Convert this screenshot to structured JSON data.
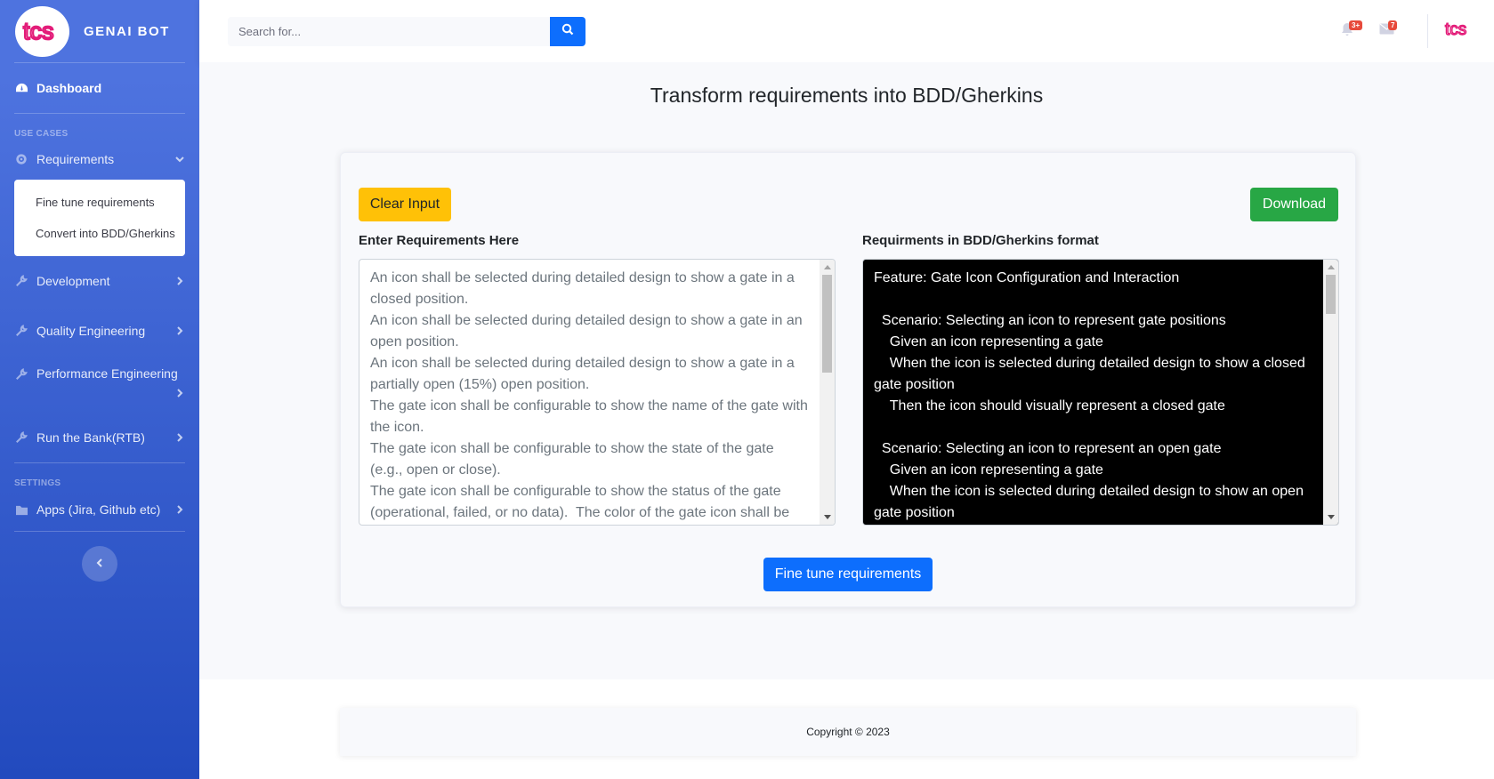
{
  "brand": {
    "name": "GENAI BOT"
  },
  "sidebar": {
    "dashboard": "Dashboard",
    "heading_use_cases": "USE CASES",
    "requirements": "Requirements",
    "submenu": [
      "Fine tune requirements",
      "Convert into BDD/Gherkins"
    ],
    "development": "Development",
    "quality": "Quality Engineering",
    "performance": "Performance Engineering",
    "rtb": "Run the Bank(RTB)",
    "heading_settings": "SETTINGS",
    "apps": "Apps (Jira, Github etc)"
  },
  "topbar": {
    "search_placeholder": "Search for...",
    "alerts_count": "3+",
    "messages_count": "7",
    "logo_text": "tcs"
  },
  "main": {
    "title": "Transform requirements into BDD/Gherkins",
    "clear_button": "Clear Input",
    "download_button": "Download",
    "input_label": "Enter Requirements Here",
    "output_label": "Requirments in BDD/Gherkins format",
    "input_text": "An icon shall be selected during detailed design to show a gate in a closed position.\nAn icon shall be selected during detailed design to show a gate in an open position.\nAn icon shall be selected during detailed design to show a gate in a partially open (15%) open position.\nThe gate icon shall be configurable to show the name of the gate with the icon.\nThe gate icon shall be configurable to show the state of the gate (e.g., open or close).\nThe gate icon shall be configurable to show the status of the gate (operational, failed, or no data).  The color of the gate icon shall be",
    "output_text": "Feature: Gate Icon Configuration and Interaction\n\n  Scenario: Selecting an icon to represent gate positions\n    Given an icon representing a gate\n    When the icon is selected during detailed design to show a closed gate position\n    Then the icon should visually represent a closed gate\n\n  Scenario: Selecting an icon to represent an open gate\n    Given an icon representing a gate\n    When the icon is selected during detailed design to show an open gate position",
    "finetune_button": "Fine tune requirements"
  },
  "footer": {
    "copyright": "Copyright © 2023"
  },
  "colors": {
    "primary": "#4e73df",
    "accent": "#e31c79",
    "warning": "#ffc107",
    "success": "#28a745",
    "button_blue": "#0d6efd"
  },
  "icons": [
    "tcs-logo",
    "dashboard-icon",
    "gear-icon",
    "chevron-down-icon",
    "chevron-right-icon",
    "wrench-icon",
    "folder-icon",
    "chevron-left-icon",
    "search-icon",
    "bell-icon",
    "envelope-icon"
  ]
}
